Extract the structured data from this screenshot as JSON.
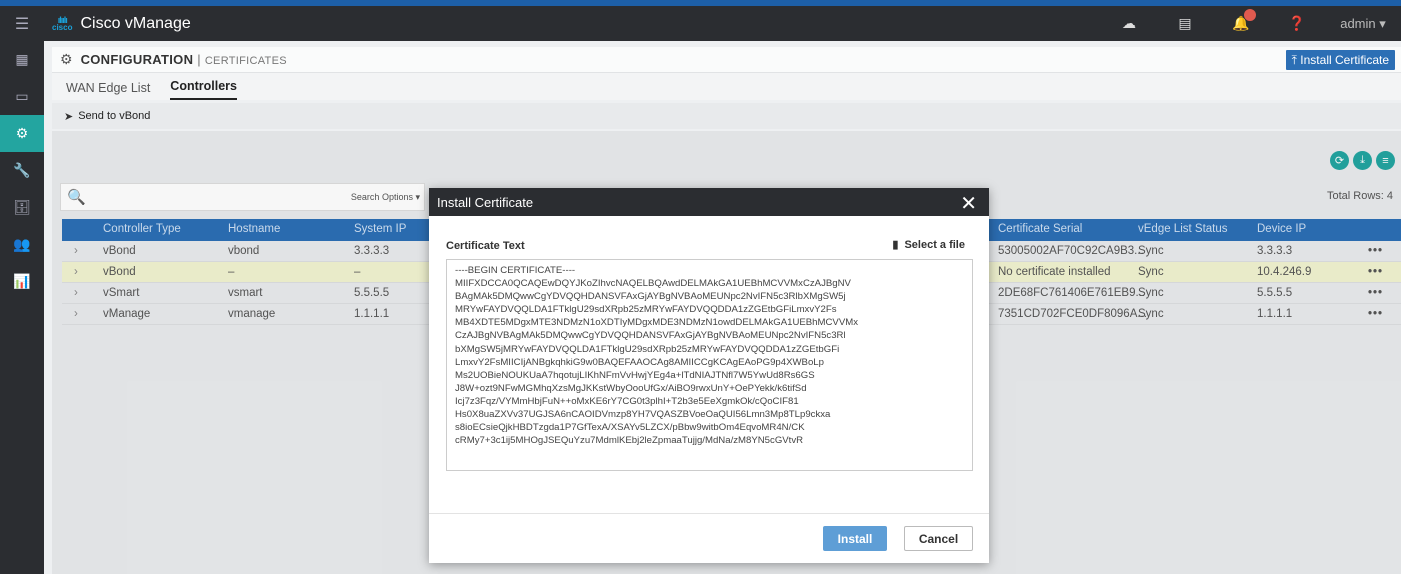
{
  "app": {
    "brand": "cisco",
    "title": "Cisco vManage",
    "user": "admin"
  },
  "colors": {
    "accent": "#23a5a0",
    "primary": "#2c6fb5",
    "topbar": "#2b2d31"
  },
  "header": {
    "section": "CONFIGURATION",
    "separator": "|",
    "subsection": "CERTIFICATES",
    "install_button": "Install Certificate"
  },
  "tabs": [
    {
      "label": "WAN Edge List"
    },
    {
      "label": "Controllers"
    }
  ],
  "actions": {
    "send_to_vbond": "Send to vBond"
  },
  "search": {
    "options_label": "Search Options"
  },
  "table": {
    "total_rows": "Total Rows: 4",
    "columns": [
      "Controller Type",
      "Hostname",
      "System IP",
      "Certificate Serial",
      "vEdge List Status",
      "Device IP"
    ],
    "rows": [
      {
        "type": "vBond",
        "hostname": "vbond",
        "system_ip": "3.3.3.3",
        "serial": "53005002AF70C92CA9B3...",
        "status": "Sync",
        "device_ip": "3.3.3.3",
        "more": "•••"
      },
      {
        "type": "vBond",
        "hostname": "–",
        "system_ip": "–",
        "serial": "No certificate installed",
        "status": "Sync",
        "device_ip": "10.4.246.9",
        "more": "•••"
      },
      {
        "type": "vSmart",
        "hostname": "vsmart",
        "system_ip": "5.5.5.5",
        "serial": "2DE68FC761406E761EB9...",
        "status": "Sync",
        "device_ip": "5.5.5.5",
        "more": "•••"
      },
      {
        "type": "vManage",
        "hostname": "vmanage",
        "system_ip": "1.1.1.1",
        "serial": "7351CD702FCE0DF8096A...",
        "status": "Sync",
        "device_ip": "1.1.1.1",
        "more": "•••"
      }
    ]
  },
  "modal": {
    "title": "Install Certificate",
    "field_label": "Certificate Text",
    "select_file": "Select a file",
    "certificate_lines": [
      "----BEGIN CERTIFICATE----",
      "MIIFXDCCA0QCAQEwDQYJKoZIhvcNAQELBQAwdDELMAkGA1UEBhMCVVMxCzAJBgNV",
      "BAgMAk5DMQwwCgYDVQQHDANSVFAxGjAYBgNVBAoMEUNpc2NvIFN5c3RlbXMgSW5j",
      "MRYwFAYDVQQLDA1FTklgU29sdXRpb25zMRYwFAYDVQQDDA1zZGEtbGFiLmxvY2Fs",
      "MB4XDTE5MDgxMTE3NDMzN1oXDTIyMDgxMDE3NDMzN1owdDELMAkGA1UEBhMCVVMx",
      "CzAJBgNVBAgMAk5DMQwwCgYDVQQHDANSVFAxGjAYBgNVBAoMEUNpc2NvIFN5c3Rl",
      "bXMgSW5jMRYwFAYDVQQLDA1FTklgU29sdXRpb25zMRYwFAYDVQQDDA1zZGEtbGFi",
      "LmxvY2FsMIICIjANBgkqhkiG9w0BAQEFAAOCAg8AMIICCgKCAgEAoPG9p4XWBoLp",
      "Ms2UOBieNOUKUaA7hqotujLIKhNFmVvHwjYEg4a+lTdNIAJTNfl7W5YwUd8Rs6GS",
      "J8W+ozt9NFwMGMhqXzsMgJKKstWbyOooUfGx/AiBO9rwxUnY+OePYekk/k6tifSd",
      "Icj7z3Fqz/VYMmHbjFuN++oMxKE6rY7CG0t3plhI+T2b3e5EeXgmkOk/cQoCIF81",
      "Hs0X8uaZXVv37UGJSA6nCAOIDVmzp8YH7VQASZBVoeOaQUI56Lmn3Mp8TLp9ckxa",
      "s8ioECsieQjkHBDTzgda1P7GfTexA/XSAYv5LZCX/pBbw9witbOm4EqvoMR4N/CK",
      "cRMy7+3c1ij5MHOgJSEQuYzu7MdmlKEbj2leZpmaaTujjg/MdNa/zM8YN5cGVtvR"
    ],
    "install": "Install",
    "cancel": "Cancel"
  }
}
